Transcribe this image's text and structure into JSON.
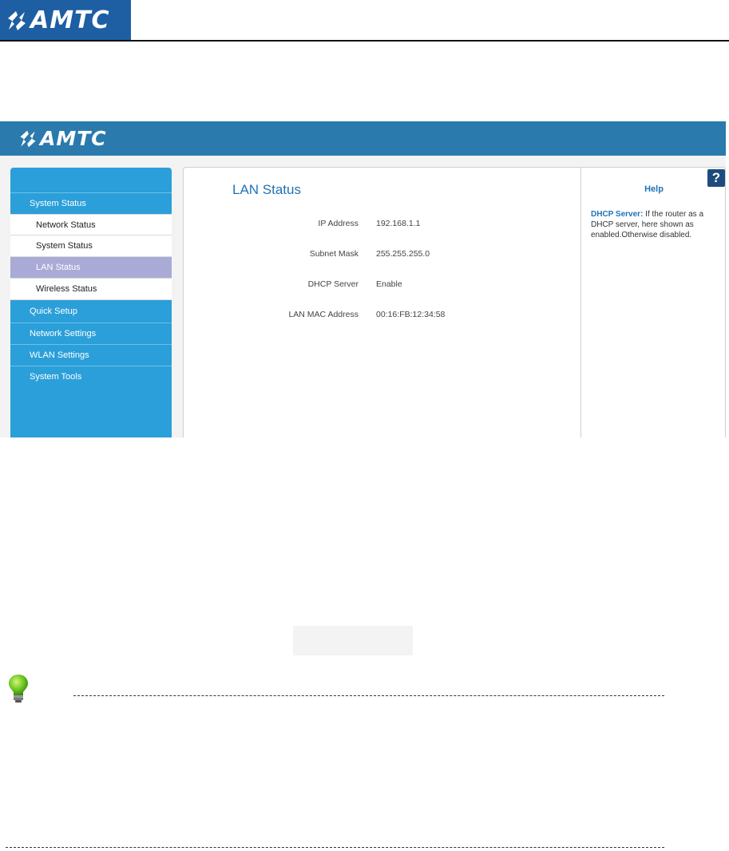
{
  "doc_header": {
    "brand": "AMTC"
  },
  "ui": {
    "brand": "AMTC",
    "sidebar": {
      "sections": [
        {
          "label": "System Status"
        },
        {
          "label": "Quick Setup"
        },
        {
          "label": "Network Settings"
        },
        {
          "label": "WLAN Settings"
        },
        {
          "label": "System Tools"
        }
      ],
      "sub_items": [
        {
          "label": "Network Status"
        },
        {
          "label": "System Status"
        },
        {
          "label": "LAN Status",
          "active": true
        },
        {
          "label": "Wireless Status"
        }
      ]
    },
    "content": {
      "title": "LAN Status",
      "rows": [
        {
          "label": "IP Address",
          "value": "192.168.1.1"
        },
        {
          "label": "Subnet Mask",
          "value": "255.255.255.0"
        },
        {
          "label": "DHCP Server",
          "value": "Enable"
        },
        {
          "label": "LAN MAC Address",
          "value": "00:16:FB:12:34:58"
        }
      ]
    },
    "help": {
      "title": "Help",
      "button": "?",
      "key": "DHCP Server:",
      "text": " If the router as a DHCP server, here shown as enabled.Otherwise disabled."
    }
  },
  "colors": {
    "header_blue": "#2a7aad",
    "logo_blue": "#1d5fa2",
    "sidebar_blue": "#2b9fd9",
    "active_item": "#a9aad6",
    "title_blue": "#1f73b7"
  },
  "icons": [
    "amtc-logo-mark",
    "help-icon",
    "lightbulb-icon"
  ]
}
